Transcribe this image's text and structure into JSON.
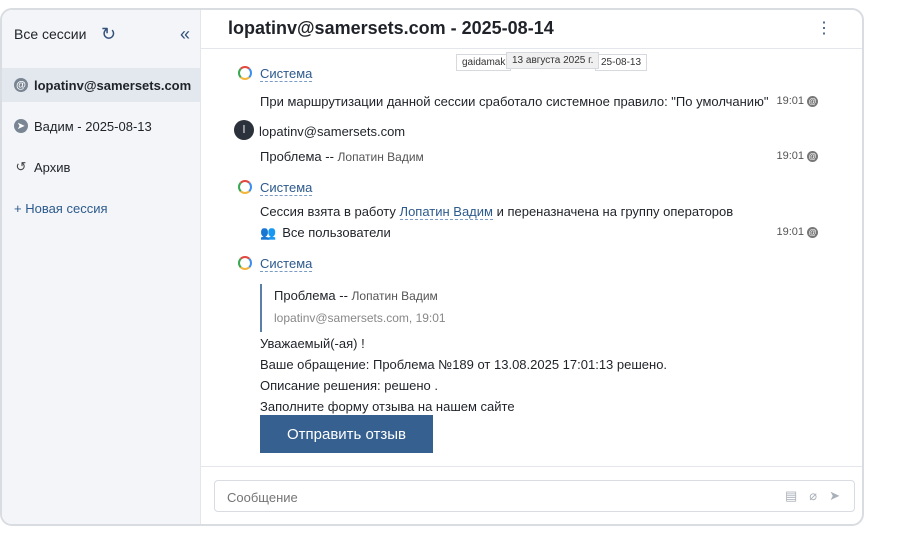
{
  "sidebar": {
    "header": "Все сессии",
    "items": [
      {
        "label": "lopatinv@samersets.com",
        "icon": "at-icon"
      },
      {
        "label": "Вадим  - 2025-08-13",
        "icon": "telegram-icon"
      },
      {
        "label": "Архив",
        "icon": "history-icon"
      },
      {
        "label": "+ Новая сессия",
        "icon": "plus-icon"
      }
    ]
  },
  "header": {
    "user": "lopatinv@samersets.com",
    "date": " - 2025-08-14"
  },
  "tooltips": {
    "t1": "gaidamak",
    "t2": "13 августа 2025 г.",
    "t3": "25-08-13"
  },
  "messages": {
    "m1_sender": "Система",
    "m1_text": "При маршрутизации данной сессии сработало системное правило: \"По умолчанию\"",
    "m1_time": "19:01",
    "m2_avatar": "l",
    "m2_sender": "lopatinv@samersets.com",
    "m2_text": "Проблема -- ",
    "m2_sub": "Лопатин Вадим",
    "m2_time": "19:01",
    "m3_sender": "Система",
    "m3_text_a": "Сессия взята в работу ",
    "m3_link": "Лопатин Вадим",
    "m3_text_b": " и переназначена на группу операторов",
    "m3_group": "Все пользователи",
    "m3_time": "19:01",
    "m4_sender": "Система",
    "quote_title": "Проблема -- ",
    "quote_name": "Лопатин Вадим",
    "quote_meta": "lopatinv@samersets.com, 19:01",
    "line1": "Уважаемый(-ая) !",
    "line2": "Ваше обращение: Проблема №189 от 13.08.2025 17:01:13 решено.",
    "line3": "Описание решения: решено .",
    "line4": "Заполните форму отзыва на нашем сайте",
    "button": "Отправить отзыв"
  },
  "composer": {
    "placeholder": "Сообщение"
  }
}
